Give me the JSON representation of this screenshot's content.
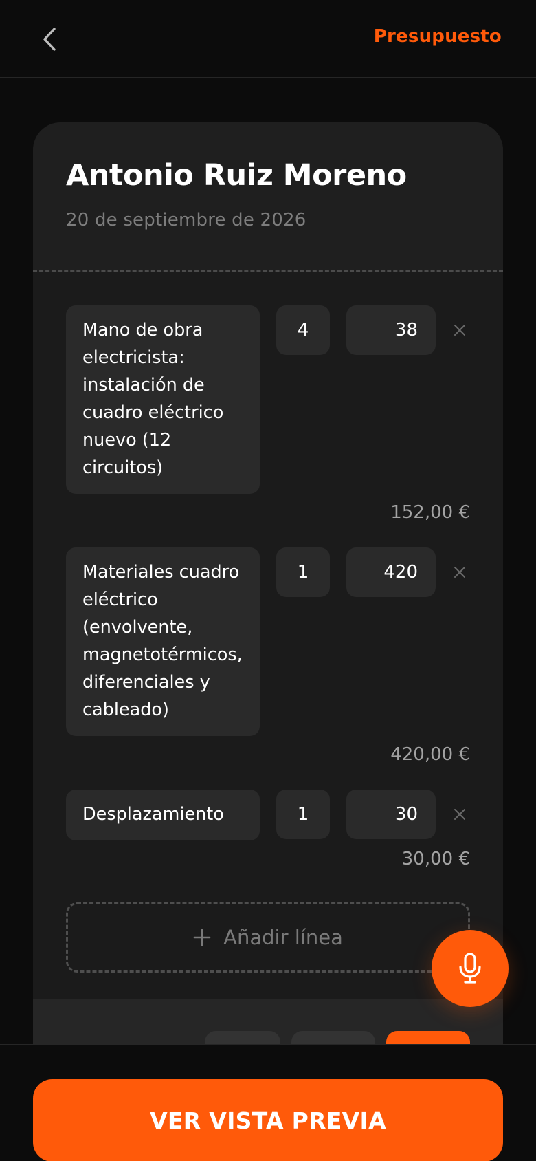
{
  "header": {
    "back_icon": "chevron-left-icon",
    "title": "Presupuesto",
    "accent_color": "#ff5a0a"
  },
  "card": {
    "client_name": "Antonio Ruiz Moreno",
    "date": "20 de septiembre de 2026"
  },
  "lines": [
    {
      "description": "Mano de obra electricista: instalación de cuadro eléctrico nuevo (12 circuitos)",
      "quantity": "4",
      "unit_price": "38",
      "total": "152,00 €"
    },
    {
      "description": "Materiales cuadro eléctrico (envolvente, magnetotérmicos, diferenciales y cableado)",
      "quantity": "1",
      "unit_price": "420",
      "total": "420,00 €"
    },
    {
      "description": "Desplazamiento",
      "quantity": "1",
      "unit_price": "30",
      "total": "30,00 €"
    }
  ],
  "add_line_label": "Añadir línea",
  "mic_icon": "microphone-icon",
  "preview_button_label": "VER VISTA PREVIA"
}
